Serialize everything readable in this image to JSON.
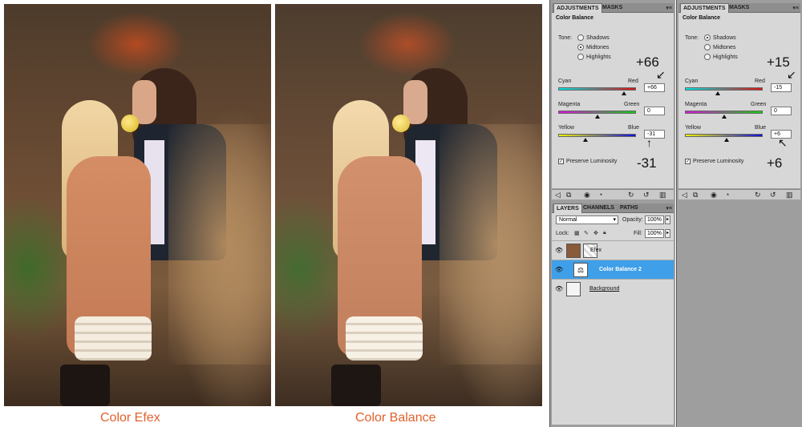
{
  "captions": {
    "left": "Color Efex",
    "right": "Color Balance"
  },
  "panel1": {
    "tabs": [
      "ADJUSTMENTS",
      "MASKS"
    ],
    "title": "Color Balance",
    "tone_label": "Tone:",
    "tones": [
      "Shadows",
      "Midtones",
      "Highlights"
    ],
    "selected_tone": "Midtones",
    "sliders": [
      {
        "left": "Cyan",
        "right": "Red",
        "value": "+66"
      },
      {
        "left": "Magenta",
        "right": "Green",
        "value": "0"
      },
      {
        "left": "Yellow",
        "right": "Blue",
        "value": "-31"
      }
    ],
    "preserve": "Preserve Luminosity",
    "preserve_checked": true,
    "annotations": [
      "+66",
      "-31"
    ]
  },
  "panel2": {
    "tabs": [
      "ADJUSTMENTS",
      "MASKS"
    ],
    "title": "Color Balance",
    "tone_label": "Tone:",
    "tones": [
      "Shadows",
      "Midtones",
      "Highlights"
    ],
    "selected_tone": "Shadows",
    "sliders": [
      {
        "left": "Cyan",
        "right": "Red",
        "value": "-15"
      },
      {
        "left": "Magenta",
        "right": "Green",
        "value": "0"
      },
      {
        "left": "Yellow",
        "right": "Blue",
        "value": "+6"
      }
    ],
    "preserve": "Preserve Luminosity",
    "preserve_checked": true,
    "annotations": [
      "+15",
      "+6"
    ]
  },
  "layers": {
    "tabs": [
      "LAYERS",
      "CHANNELS",
      "PATHS"
    ],
    "blend_mode": "Normal",
    "opacity_label": "Opacity:",
    "opacity": "100%",
    "lock_label": "Lock:",
    "fill_label": "Fill:",
    "fill": "100%",
    "items": [
      "Efex",
      "Color Balance 2",
      "Background"
    ],
    "selected": "Color Balance 2"
  },
  "colors": {
    "caption": "#e0612d",
    "panel_bg": "#d7d7d7",
    "selected_layer": "#3f9fe8"
  }
}
